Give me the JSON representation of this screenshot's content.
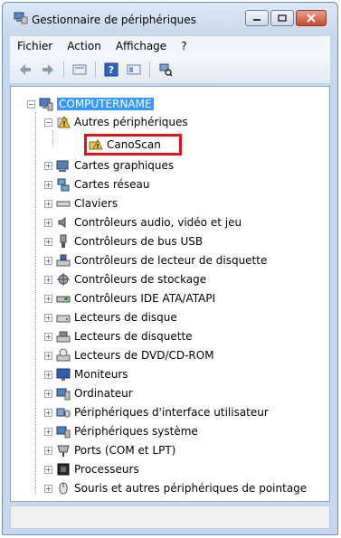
{
  "window": {
    "title": "Gestionnaire de périphériques"
  },
  "menu": {
    "items": [
      {
        "label": "Fichier"
      },
      {
        "label": "Action"
      },
      {
        "label": "Affichage"
      },
      {
        "label": "?"
      }
    ]
  },
  "toolbar": {
    "buttons": [
      "back-arrow-icon",
      "forward-arrow-icon",
      "properties-icon",
      "help-icon",
      "view-icon",
      "scan-hardware-icon"
    ]
  },
  "tree": {
    "root": "COMPUTERNAME",
    "other_devices": "Autres périphériques",
    "canoscan": "CanoScan",
    "categories": [
      "Cartes graphiques",
      "Cartes réseau",
      "Claviers",
      "Contrôleurs audio, vidéo et jeu",
      "Contrôleurs de bus USB",
      "Contrôleurs de lecteur de disquette",
      "Contrôleurs de stockage",
      "Contrôleurs IDE ATA/ATAPI",
      "Lecteurs de disque",
      "Lecteurs de disquette",
      "Lecteurs de DVD/CD-ROM",
      "Moniteurs",
      "Ordinateur",
      "Périphériques d'interface utilisateur",
      "Périphériques système",
      "Ports (COM et LPT)",
      "Processeurs",
      "Souris et autres périphériques de pointage"
    ]
  },
  "colors": {
    "selection": "#3399ff",
    "highlight_border": "#e0121b"
  }
}
